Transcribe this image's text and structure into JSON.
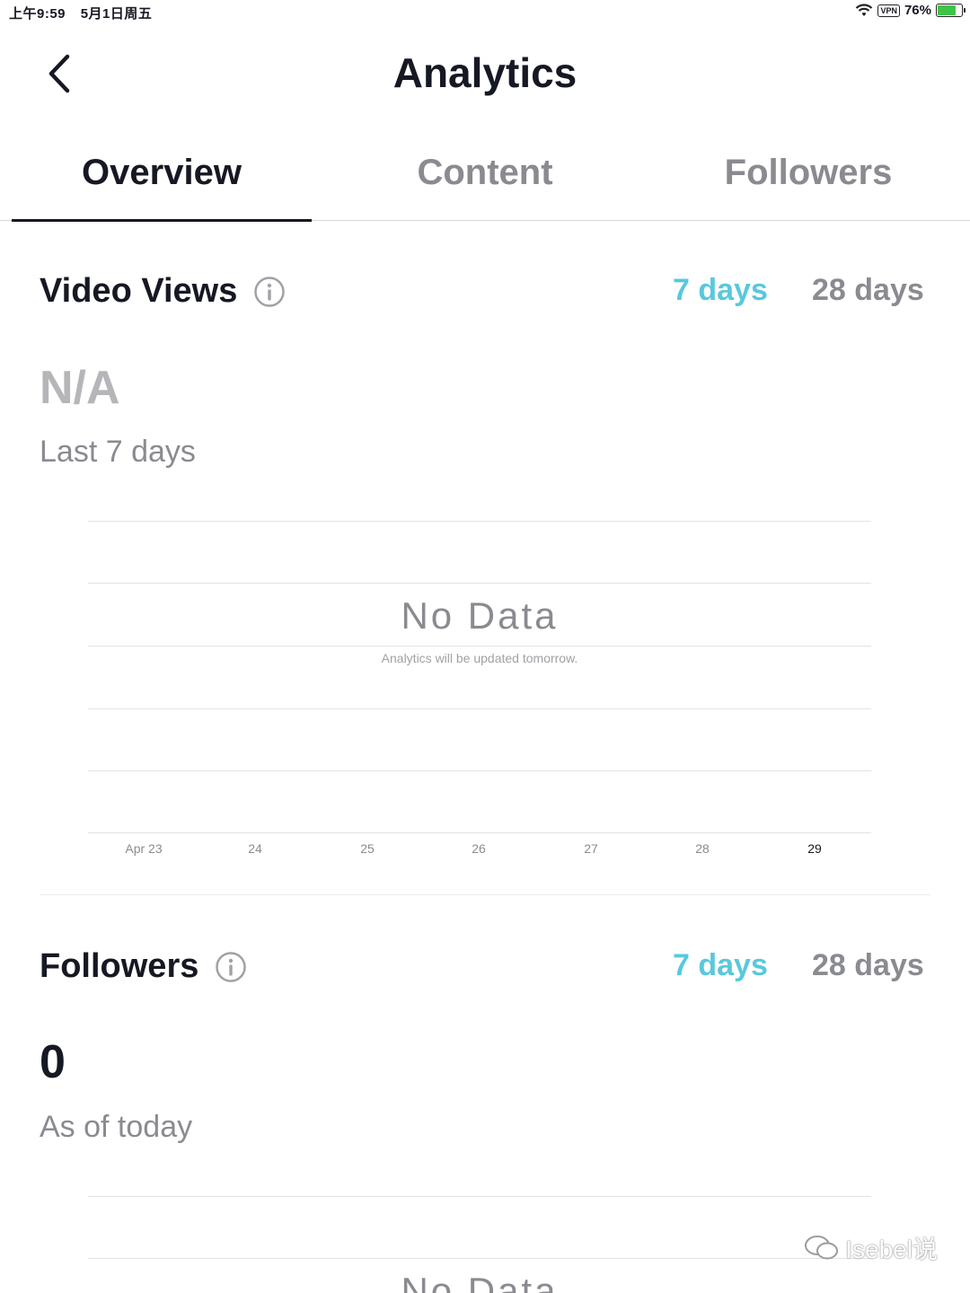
{
  "status_bar": {
    "time": "上午9:59",
    "date": "5月1日周五",
    "vpn": "VPN",
    "battery": "76%",
    "battery_level": 0.76
  },
  "header": {
    "title": "Analytics"
  },
  "tabs": [
    {
      "label": "Overview",
      "active": true
    },
    {
      "label": "Content",
      "active": false
    },
    {
      "label": "Followers",
      "active": false
    }
  ],
  "video_views": {
    "title": "Video Views",
    "range_7": "7 days",
    "range_28": "28 days",
    "value": "N/A",
    "period": "Last 7 days",
    "no_data": "No Data",
    "no_data_sub": "Analytics will be updated tomorrow.",
    "x_ticks": [
      "Apr 23",
      "24",
      "25",
      "26",
      "27",
      "28",
      "29"
    ]
  },
  "followers": {
    "title": "Followers",
    "range_7": "7 days",
    "range_28": "28 days",
    "value": "0",
    "period": "As of today",
    "no_data": "No Data"
  },
  "watermark": {
    "text": "Isebel说"
  },
  "colors": {
    "accent": "#59c8dd",
    "text": "#161823",
    "muted": "#8a8b91"
  }
}
